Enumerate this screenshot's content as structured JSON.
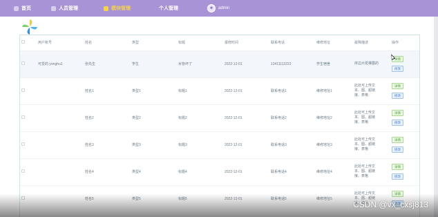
{
  "nav": {
    "items": [
      {
        "label": "首页",
        "icon": "home-icon"
      },
      {
        "label": "人员管理",
        "icon": "users-icon"
      },
      {
        "label": "模块管理",
        "icon": "module-icon",
        "active": true
      },
      {
        "label": "个人管理",
        "icon": "person-icon"
      }
    ],
    "admin": "admin"
  },
  "table": {
    "headers": [
      "用户账号",
      "姓名",
      "类型",
      "标题",
      "报修时间",
      "联系电话",
      "维修地址",
      "故障描述",
      "操作"
    ],
    "rows": [
      {
        "account": "可爱的 yonghu1",
        "name": "张先生",
        "type": "学生",
        "title": "水管坏了",
        "date": "2022-12-01",
        "phone": "13411112222",
        "address": "学生宿舍",
        "desc": "床边大斑裸露的"
      },
      {
        "account": "",
        "name": "姓名1",
        "type": "类型1",
        "title": "标题1",
        "date": "2022-12-01",
        "phone": "联系电话1",
        "address": "维修地址1",
        "desc": "此处可上传文本、图、超链接、表格"
      },
      {
        "account": "",
        "name": "姓名2",
        "type": "类型2",
        "title": "标题2",
        "date": "2022-12-01",
        "phone": "联系电话2",
        "address": "维修地址2",
        "desc": "此处可上传文本、图、超链接、表格"
      },
      {
        "account": "",
        "name": "姓名3",
        "type": "类型3",
        "title": "标题3",
        "date": "2022-12-01",
        "phone": "联系电话3",
        "address": "维修地址3",
        "desc": "此处可上传文本、图、超链接、表格"
      },
      {
        "account": "",
        "name": "姓名4",
        "type": "类型4",
        "title": "标题4",
        "date": "2022-12-01",
        "phone": "联系电话4",
        "address": "维修地址4",
        "desc": "此处可上传文本、图、超链接、表格"
      },
      {
        "account": "",
        "name": "姓名5",
        "type": "类型5",
        "title": "标题5",
        "date": "2022-12-01",
        "phone": "联系电话5",
        "address": "维修地址5",
        "desc": "此处可上传文本、图、超链接、表格"
      }
    ],
    "detail_label": "详情",
    "edit_label": "修改"
  },
  "watermark": "CSDN @vx_cxsj813",
  "colors": {
    "nav_bg": "#a893d6",
    "nav_active": "#f5d24a",
    "detail": "#4fa63a",
    "edit": "#3f7fd0"
  }
}
